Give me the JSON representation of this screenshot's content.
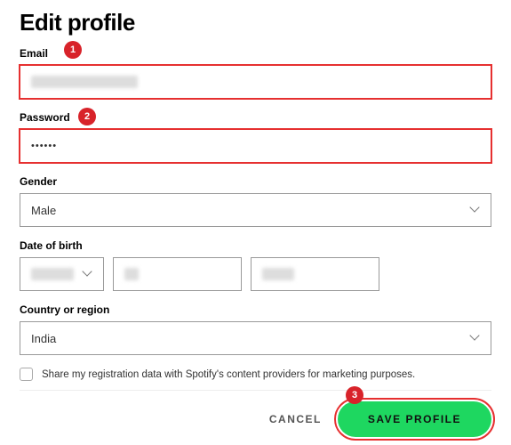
{
  "title": "Edit profile",
  "email": {
    "label": "Email"
  },
  "password": {
    "label": "Password",
    "masked": "••••••"
  },
  "gender": {
    "label": "Gender",
    "value": "Male"
  },
  "dob": {
    "label": "Date of birth"
  },
  "country": {
    "label": "Country or region",
    "value": "India"
  },
  "marketing": {
    "label": "Share my registration data with Spotify's content providers for marketing purposes."
  },
  "actions": {
    "cancel": "CANCEL",
    "save": "SAVE PROFILE"
  },
  "annotations": {
    "a1": "1",
    "a2": "2",
    "a3": "3"
  }
}
